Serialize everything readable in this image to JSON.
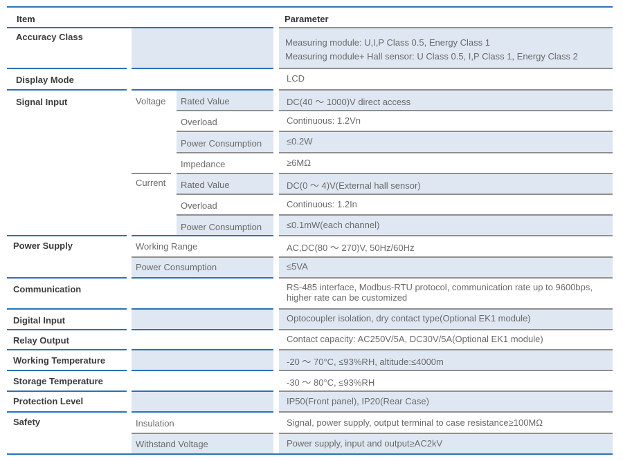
{
  "header": {
    "item": "Item",
    "parameter": "Parameter"
  },
  "rows": {
    "accuracy": {
      "label": "Accuracy Class",
      "value_lines": [
        "Measuring module: U,I,P Class 0.5, Energy Class 1",
        "Measuring module+ Hall sensor: U Class 0.5, I,P Class 1, Energy Class 2"
      ]
    },
    "display": {
      "label": "Display Mode",
      "value": "LCD"
    },
    "signal": {
      "label": "Signal Input",
      "voltage": {
        "label": "Voltage",
        "rated_label": "Rated Value",
        "rated_value": "DC(40 ～ 1000)V direct access",
        "overload_label": "Overload",
        "overload_value": "Continuous: 1.2Vn",
        "power_label": "Power Consumption",
        "power_value": "≤0.2W",
        "impedance_label": "Impedance",
        "impedance_value": "≥6MΩ"
      },
      "current": {
        "label": "Current",
        "rated_label": "Rated Value",
        "rated_value": "DC(0 ～ 4)V(External hall sensor)",
        "overload_label": "Overload",
        "overload_value": "Continuous: 1.2In",
        "power_label": "Power Consumption",
        "power_value": "≤0.1mW(each channel)"
      }
    },
    "power": {
      "label": "Power Supply",
      "range_label": "Working Range",
      "range_value": "AC,DC(80 ～ 270)V, 50Hz/60Hz",
      "consumption_label": "Power Consumption",
      "consumption_value": "≤5VA"
    },
    "communication": {
      "label": "Communication",
      "value_lines": [
        "RS-485 interface, Modbus-RTU protocol, communication rate up to 9600bps,",
        "higher rate can be customized"
      ]
    },
    "digital_input": {
      "label": "Digital Input",
      "value": "Optocoupler isolation, dry contact type(Optional EK1 module)"
    },
    "relay_output": {
      "label": "Relay Output",
      "value": "Contact capacity: AC250V/5A, DC30V/5A(Optional EK1 module)"
    },
    "working_temp": {
      "label": "Working Temperature",
      "value": "-20 ～ 70°C, ≤93%RH, altitude:≤4000m"
    },
    "storage_temp": {
      "label": "Storage Temperature",
      "value": "-30 ～ 80°C, ≤93%RH"
    },
    "protection": {
      "label": "Protection Level",
      "value": "IP50(Front panel), IP20(Rear Case)"
    },
    "safety": {
      "label": "Safety",
      "insulation_label": "Insulation",
      "insulation_value": "Signal, power supply, output terminal to case resistance≥100MΩ",
      "withstand_label": "Withstand Voltage",
      "withstand_value": "Power supply, input and output≥AC2kV"
    }
  }
}
